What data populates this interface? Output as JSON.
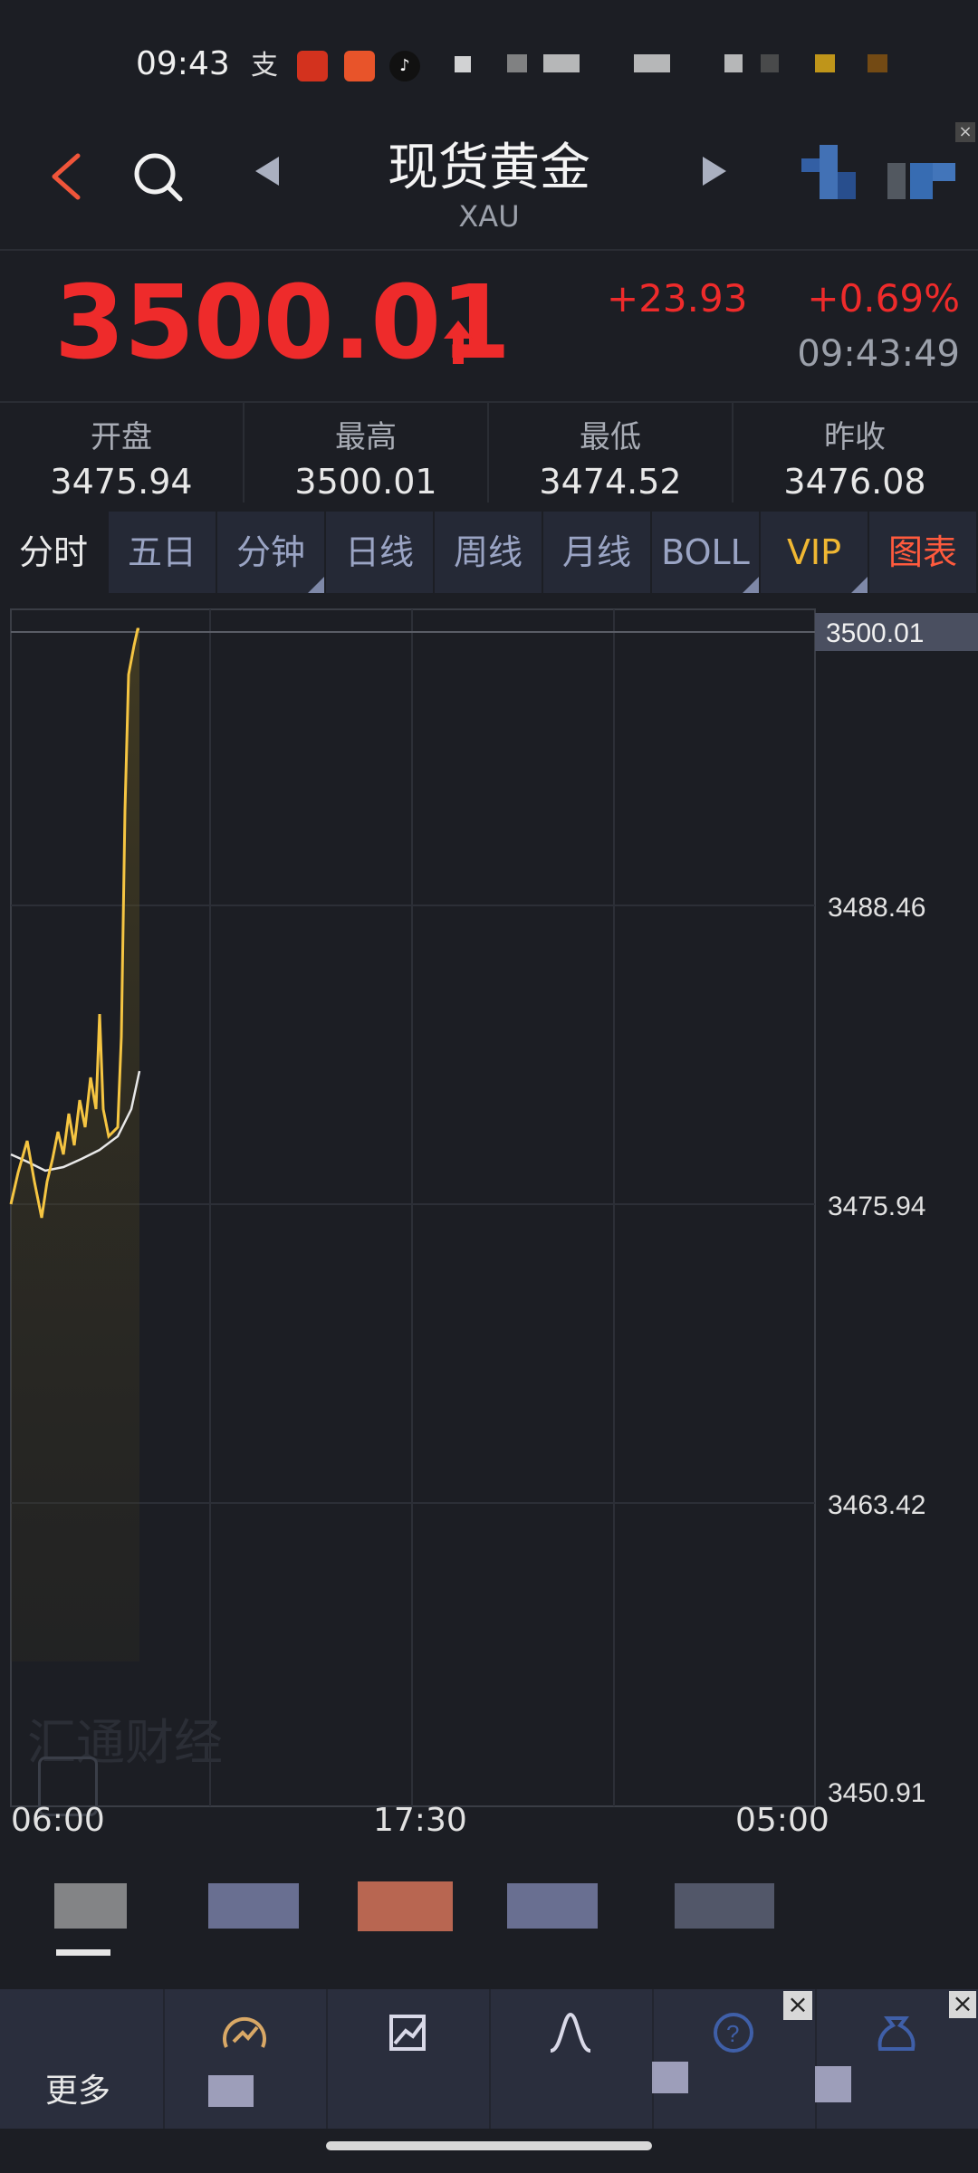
{
  "status_bar": {
    "time": "09:43"
  },
  "header": {
    "title": "现货黄金",
    "subtitle": "XAU"
  },
  "quote": {
    "price": "3500.01",
    "change": "+23.93",
    "change_pct": "+0.69%",
    "time": "09:43:49"
  },
  "stats": [
    {
      "label": "开盘",
      "value": "3475.94"
    },
    {
      "label": "最高",
      "value": "3500.01"
    },
    {
      "label": "最低",
      "value": "3474.52"
    },
    {
      "label": "昨收",
      "value": "3476.08"
    }
  ],
  "tabs": [
    {
      "label": "分时",
      "active": true
    },
    {
      "label": "五日"
    },
    {
      "label": "分钟"
    },
    {
      "label": "日线"
    },
    {
      "label": "周线"
    },
    {
      "label": "月线"
    },
    {
      "label": "BOLL"
    },
    {
      "label": "VIP"
    },
    {
      "label": "图表"
    }
  ],
  "chart_data": {
    "type": "line",
    "current_price_label": "3500.01",
    "y_ticks": [
      "3488.46",
      "3475.94",
      "3463.42",
      "3450.91"
    ],
    "x_ticks": [
      "06:00",
      "17:30",
      "05:00"
    ],
    "colors": {
      "price_line": "#f5c542",
      "avg_line": "#e8e8e8",
      "up": "#ee2b2b"
    }
  },
  "bottom": {
    "more_label": "更多"
  },
  "watermark": "汇通财经"
}
